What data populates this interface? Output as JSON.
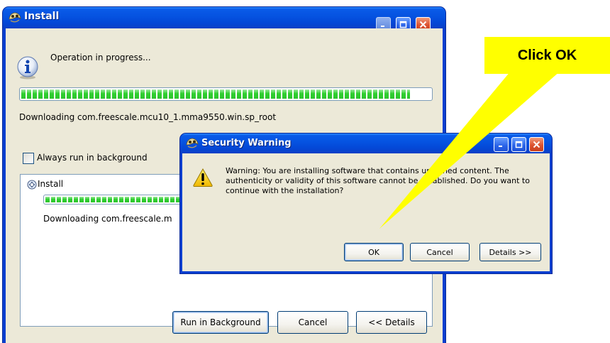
{
  "install_window": {
    "title": "Install",
    "status_text": "Operation in progress...",
    "main_progress": 0.95,
    "downloading_text": "Downloading com.freescale.mcu10_1.mma9550.win.sp_root",
    "always_background_label": "Always run in background",
    "always_background_checked": false,
    "task_name": "Install",
    "task_progress": 0.95,
    "task_downloading_text": "Downloading com.freescale.m",
    "buttons": {
      "run_background": "Run in Background",
      "cancel": "Cancel",
      "details": "<< Details"
    }
  },
  "security_dialog": {
    "title": "Security Warning",
    "message_line1": "Warning: You are installing software that contains unsigned content. The",
    "message_line2": "authenticity or validity of this software cannot be established. Do you want to",
    "message_line3": "continue with the installation?",
    "buttons": {
      "ok": "OK",
      "cancel": "Cancel",
      "details": "Details >>"
    }
  },
  "callout": {
    "text": "Click OK",
    "color": "#ffff00"
  },
  "icons": {
    "app_icon": "install-wizard-icon",
    "info_icon": "info-icon",
    "warning_icon": "warning-icon",
    "task_icon": "install-task-icon"
  },
  "colors": {
    "titlebar": "#0552e0",
    "client": "#ece9d8",
    "progress": "#2fcf2f",
    "close_button": "#dc5230"
  }
}
